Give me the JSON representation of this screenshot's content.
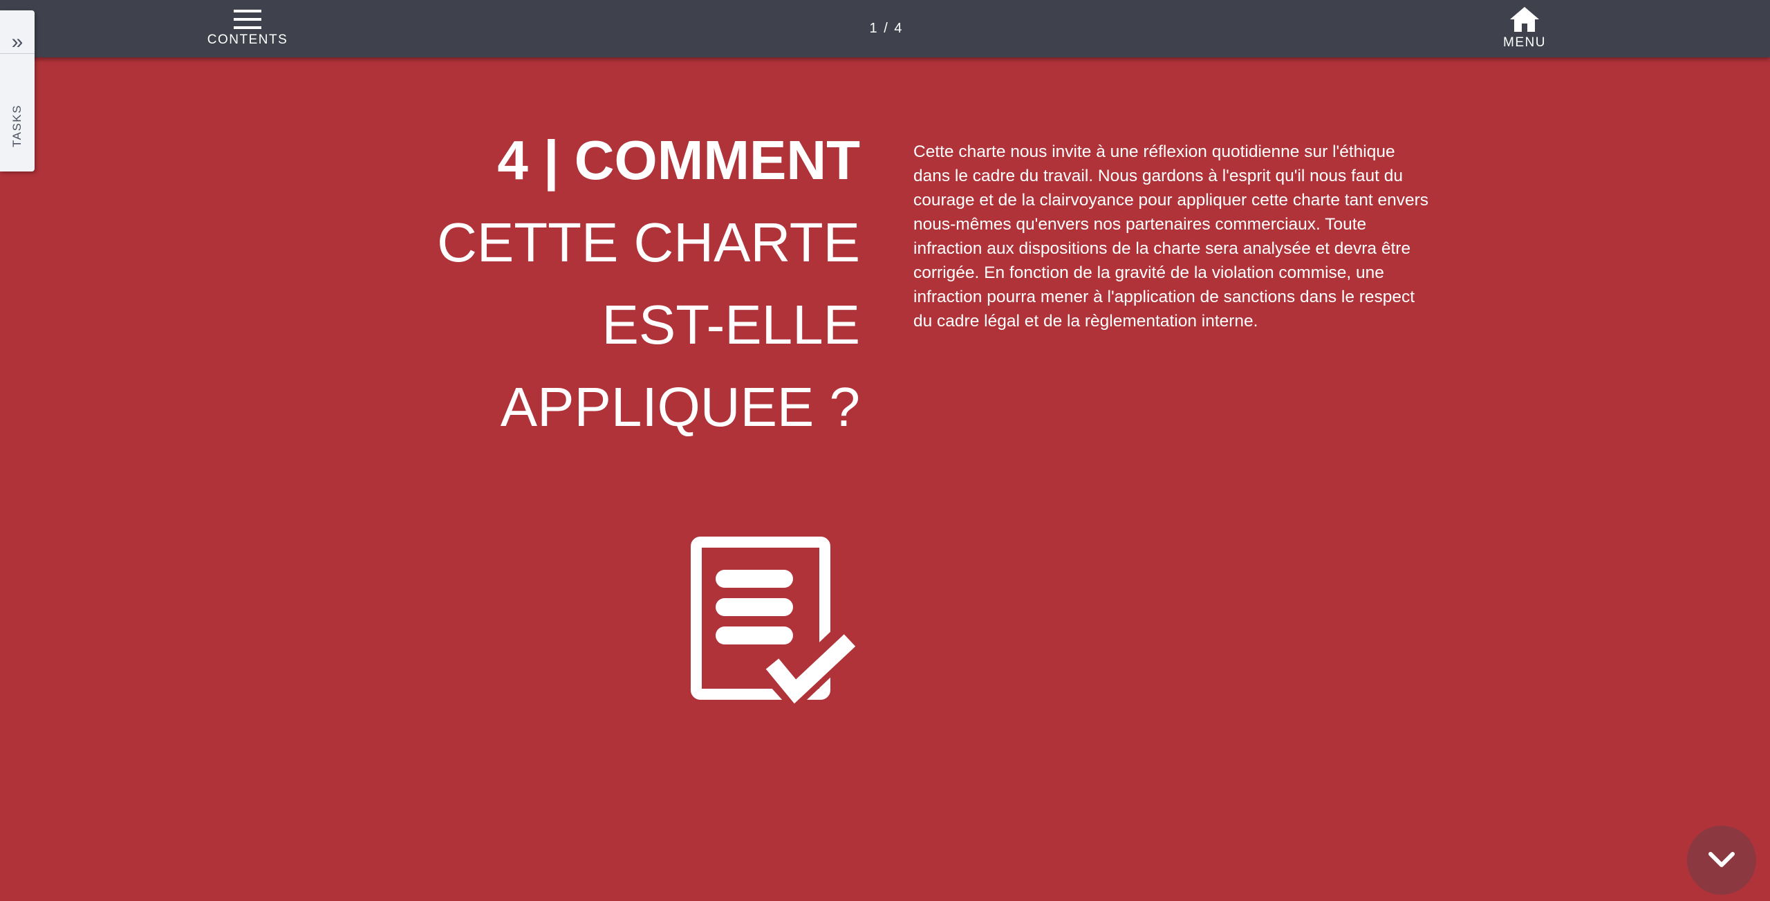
{
  "topbar": {
    "contents_label": "CONTENTS",
    "page_counter": "1 / 4",
    "menu_label": "MENU"
  },
  "tasks": {
    "expand_glyph": "»",
    "label": "TASKS"
  },
  "section": {
    "heading_line1": "4 | COMMENT",
    "heading_line2": "CETTE CHARTE",
    "heading_line3": "EST-ELLE",
    "heading_line4": "APPLIQUEE ?",
    "body": "Cette charte nous invite à une réflexion quotidienne sur l'éthique dans le cadre du travail. Nous gardons à l'esprit qu'il nous faut du courage et de la clairvoyance pour appliquer cette charte tant envers nous-mêmes qu'envers nos partenaires commerciaux. Toute infraction aux dispositions de la charte sera analysée et devra être corrigée. En fonction de la gravité de la violation commise, une infraction pourra mener à l'application de sanctions dans le respect du cadre légal et de la règlementation interne.",
    "icon": "document-check-icon"
  },
  "colors": {
    "background": "#b03339",
    "topbar": "#3f424d",
    "tasks_tab": "#f1f3f6",
    "scroll_button": "#8c3840",
    "text": "#ffffff"
  },
  "icons": {
    "contents": "hamburger-icon",
    "menu": "home-icon",
    "scroll": "chevron-down-icon",
    "tasks_expand": "double-chevron-right-icon"
  }
}
